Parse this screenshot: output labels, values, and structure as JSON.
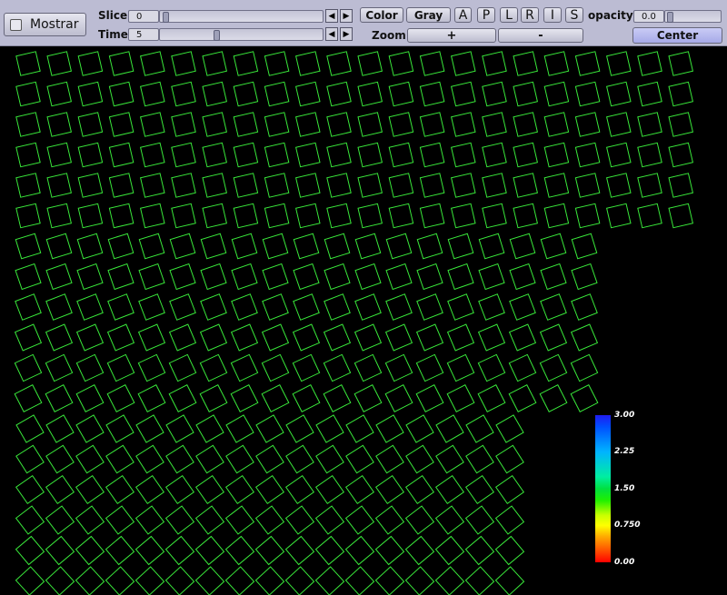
{
  "toolbar": {
    "mostrar_label": "Mostrar",
    "slice_label": "Slice",
    "slice_value": "0",
    "time_label": "Time",
    "time_value": "5",
    "color_label": "Color",
    "gray_label": "Gray",
    "view_buttons": [
      "A",
      "P",
      "L",
      "R",
      "I",
      "S"
    ],
    "opacity_label": "opacity",
    "opacity_value": "0.0",
    "zoom_label": "Zoom",
    "zoom_in_label": "+",
    "zoom_out_label": "-",
    "center_label": "Center",
    "left_arrow": "◀",
    "right_arrow": "▶"
  },
  "colorbar": {
    "labels": [
      "3.00",
      "2.25",
      "1.50",
      "0.750",
      "0.00"
    ],
    "top_color": "#1f1cf0",
    "bottom_color": "#ff0000"
  },
  "glyph_color": "#39e83a"
}
